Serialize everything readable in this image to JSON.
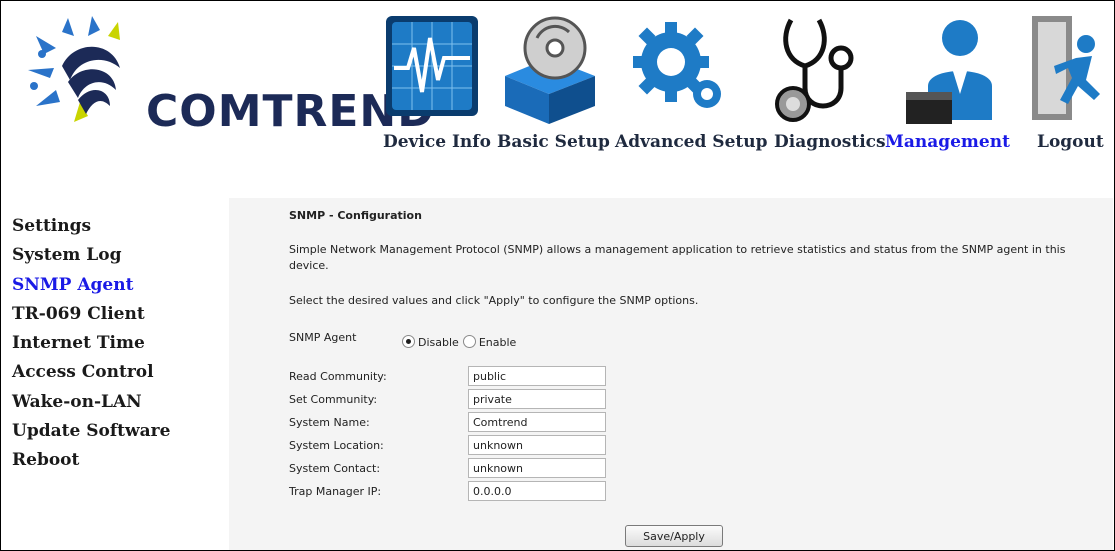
{
  "brand": {
    "name": "COMTREND",
    "primary_color": "#1c2a57",
    "active_color": "#1a1ae6"
  },
  "nav": {
    "items": [
      {
        "label": "Device Info",
        "icon": "device-info-icon"
      },
      {
        "label": "Basic Setup",
        "icon": "basic-setup-icon"
      },
      {
        "label": "Advanced Setup",
        "icon": "advanced-setup-icon"
      },
      {
        "label": "Diagnostics",
        "icon": "diagnostics-icon"
      },
      {
        "label": "Management",
        "icon": "management-icon",
        "active": true
      },
      {
        "label": "Logout",
        "icon": "logout-icon"
      }
    ]
  },
  "sidebar": {
    "items": [
      {
        "label": "Settings"
      },
      {
        "label": "System Log"
      },
      {
        "label": "SNMP Agent",
        "active": true
      },
      {
        "label": "TR-069 Client"
      },
      {
        "label": "Internet Time"
      },
      {
        "label": "Access Control"
      },
      {
        "label": "Wake-on-LAN"
      },
      {
        "label": "Update Software"
      },
      {
        "label": "Reboot"
      }
    ]
  },
  "main": {
    "title": "SNMP - Configuration",
    "description": "Simple Network Management Protocol (SNMP) allows a management application to retrieve statistics and status from the SNMP agent in this device.",
    "select_text": "Select the desired values and click \"Apply\" to configure the SNMP options.",
    "agent_label": "SNMP Agent",
    "disable_label": "Disable",
    "enable_label": "Enable",
    "agent_value": "Disable",
    "fields": [
      {
        "label": "Read Community:",
        "value": "public"
      },
      {
        "label": "Set Community:",
        "value": "private"
      },
      {
        "label": "System Name:",
        "value": "Comtrend"
      },
      {
        "label": "System Location:",
        "value": "unknown"
      },
      {
        "label": "System Contact:",
        "value": "unknown"
      },
      {
        "label": "Trap Manager IP:",
        "value": "0.0.0.0"
      }
    ],
    "save_label": "Save/Apply"
  }
}
